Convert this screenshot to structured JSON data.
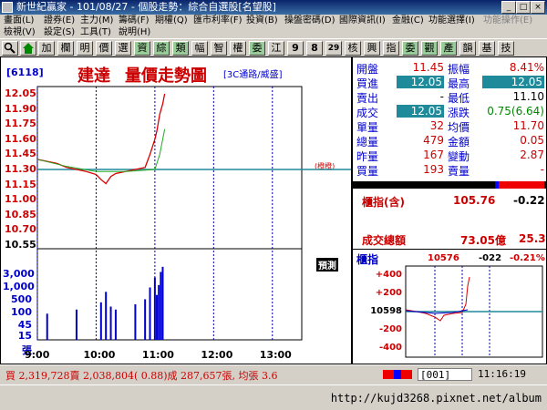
{
  "window": {
    "title": "新世紀贏家 - 101/08/27 - 個股走勢：綜合自選股[名望股]",
    "controls": {
      "minimize": "_",
      "maximize": "□",
      "close": "×"
    }
  },
  "menu": {
    "row1": [
      "畫面(L)",
      "證券(E)",
      "主力(M)",
      "籌碼(F)",
      "期權(Q)",
      "匯市利率(F)",
      "投資(B)",
      "操盤密碼(D)",
      "國際資訊(I)",
      "金融(C)",
      "功能選擇(I)",
      "功能操作(E)"
    ],
    "row2": [
      "檢視(V)",
      "設定(S)",
      "工具(T)",
      "說明(H)"
    ]
  },
  "toolbar": {
    "buttons": [
      "加",
      "欄",
      "明",
      "價",
      "選",
      "資",
      "綜",
      "類",
      "幅",
      "智",
      "權",
      "委",
      "江",
      "9",
      "8",
      "29",
      "核",
      "興",
      "指",
      "委",
      "觀",
      "產",
      "韻",
      "基",
      "技"
    ]
  },
  "stock": {
    "code": "[6118]",
    "name": "建達",
    "chart_title": "量價走勢圖",
    "category": "[3C通路/威盛]",
    "ref_label": "(橙橙)",
    "predict_label": "預測"
  },
  "chart_data": {
    "type": "line",
    "price_axis": {
      "ticks": [
        "12.05",
        "11.90",
        "11.75",
        "11.60",
        "11.45",
        "11.30",
        "11.15",
        "11.00",
        "10.85",
        "10.70",
        "10.55"
      ],
      "ylim": [
        10.55,
        12.05
      ],
      "ref_price": 11.3
    },
    "volume_axis": {
      "ticks": [
        "3,000",
        "1,000",
        "500",
        "100",
        "45",
        "15",
        "張"
      ]
    },
    "x_ticks": [
      "9:00",
      "10:00",
      "11:00",
      "12:00",
      "13:00"
    ],
    "price_series": {
      "x": [
        "09:00",
        "09:10",
        "09:20",
        "09:30",
        "09:40",
        "09:50",
        "10:00",
        "10:05",
        "10:10",
        "10:15",
        "10:20",
        "10:30",
        "10:40",
        "10:50",
        "10:55",
        "11:00",
        "11:02",
        "11:05",
        "11:08",
        "11:10"
      ],
      "values": [
        11.4,
        11.38,
        11.36,
        11.32,
        11.3,
        11.28,
        11.25,
        11.2,
        11.16,
        11.23,
        11.26,
        11.28,
        11.3,
        11.32,
        11.45,
        11.6,
        11.68,
        11.85,
        11.95,
        12.05
      ]
    },
    "avg_series": {
      "x": [
        "09:00",
        "09:30",
        "10:00",
        "10:30",
        "11:00",
        "11:05",
        "11:10"
      ],
      "values": [
        11.4,
        11.33,
        11.28,
        11.28,
        11.3,
        11.45,
        11.7
      ]
    },
    "volume_series": {
      "x": [
        "09:10",
        "09:40",
        "10:05",
        "10:10",
        "10:15",
        "10:20",
        "10:40",
        "10:50",
        "10:55",
        "11:00",
        "11:02",
        "11:04",
        "11:06",
        "11:08"
      ],
      "values": [
        10,
        15,
        30,
        80,
        20,
        15,
        25,
        40,
        120,
        300,
        60,
        150,
        500,
        800
      ]
    }
  },
  "quote": {
    "rows": [
      {
        "l1": "開盤",
        "v1": "11.45",
        "c1": "red",
        "l2": "振幅",
        "v2": "8.41%",
        "c2": "red"
      },
      {
        "l1": "買進",
        "v1": "12.05",
        "c1": "box",
        "l2": "最高",
        "v2": "12.05",
        "c2": "box"
      },
      {
        "l1": "賣出",
        "v1": "-",
        "c1": "blk",
        "l2": "最低",
        "v2": "11.10",
        "c2": "blk"
      },
      {
        "l1": "成交",
        "v1": "12.05",
        "c1": "box",
        "l2": "漲跌",
        "v2": "0.75(6.64)",
        "c2": "grn"
      },
      {
        "l1": "單量",
        "v1": "32",
        "c1": "red",
        "l2": "均價",
        "v2": "11.70",
        "c2": "red"
      },
      {
        "l1": "總量",
        "v1": "479",
        "c1": "red",
        "l2": "金額",
        "v2": "0.05",
        "c2": "red"
      },
      {
        "l1": "昨量",
        "v1": "167",
        "c1": "red",
        "l2": "變動",
        "v2": "2.87",
        "c2": "red"
      },
      {
        "l1": "買量",
        "v1": "193",
        "c1": "red",
        "l2": "賣量",
        "v2": "-",
        "c2": "red"
      }
    ]
  },
  "index": {
    "label": "櫃指(含)",
    "value": "105.76",
    "change": "-0.22",
    "turnover_label": "成交總額",
    "turnover": "73.05億",
    "turnover_chg": "25.3",
    "mini_label": "櫃指",
    "mini_value": "10576",
    "mini_change": "-022",
    "mini_pct": "-0.21%",
    "mini_ref": "10598",
    "mini_ticks": [
      "+400",
      "+200",
      "10598",
      "-200",
      "-400"
    ]
  },
  "status": {
    "text": "買 2,319,728賣 2,038,804( 0.88)成 287,657張, 均張 3.6",
    "code_box": "001",
    "time": "11:16:19"
  },
  "taskbar": {
    "url": "http://kujd3268.pixnet.net/album"
  }
}
